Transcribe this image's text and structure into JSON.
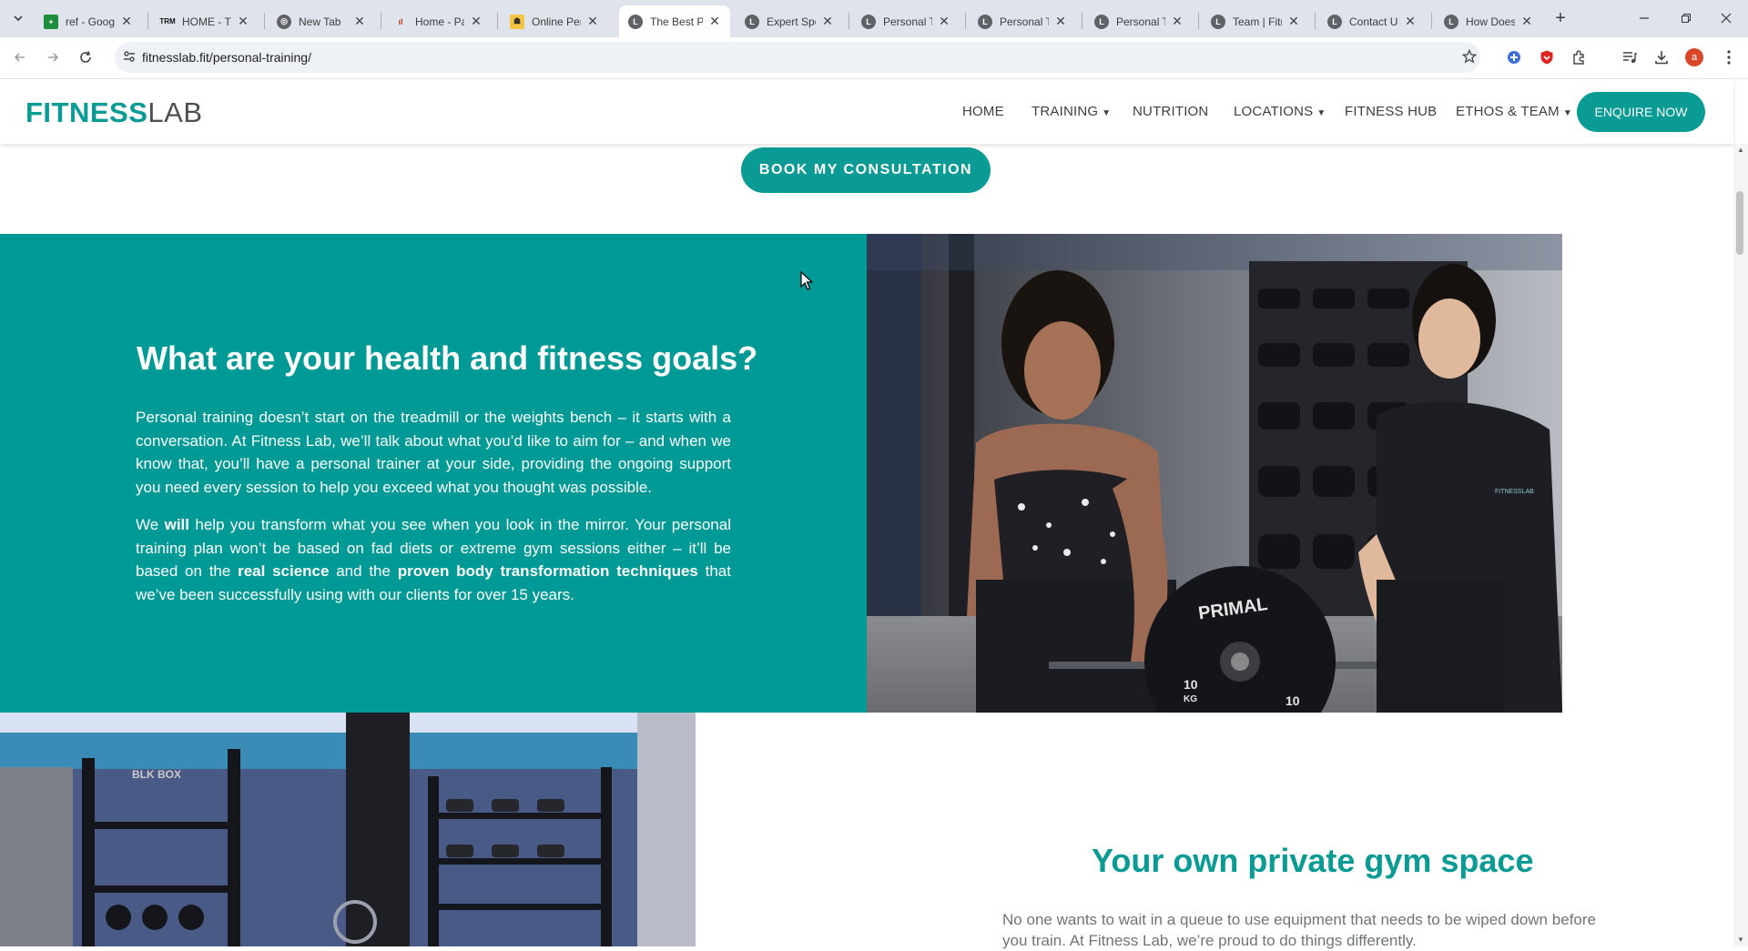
{
  "browser": {
    "tabs": [
      {
        "title": "ref - Goog",
        "icon": "sheets-icon",
        "active": false
      },
      {
        "title": "HOME - Th",
        "icon": "trm-icon",
        "active": false
      },
      {
        "title": "New Tab",
        "icon": "chrome-icon",
        "active": false
      },
      {
        "title": "Home - Pa",
        "icon": "site-icon",
        "active": false
      },
      {
        "title": "Online Per",
        "icon": "site-icon",
        "active": false
      },
      {
        "title": "The Best P",
        "icon": "fitnesslab-icon",
        "active": true
      },
      {
        "title": "Expert Spo",
        "icon": "fitnesslab-icon",
        "active": false
      },
      {
        "title": "Personal Tr",
        "icon": "fitnesslab-icon",
        "active": false
      },
      {
        "title": "Personal Tr",
        "icon": "fitnesslab-icon",
        "active": false
      },
      {
        "title": "Personal Tr",
        "icon": "fitnesslab-icon",
        "active": false
      },
      {
        "title": "Team | Fitn",
        "icon": "fitnesslab-icon",
        "active": false
      },
      {
        "title": "Contact Us",
        "icon": "fitnesslab-icon",
        "active": false
      },
      {
        "title": "How Does",
        "icon": "fitnesslab-icon",
        "active": false
      }
    ],
    "url": "fitnesslab.fit/personal-training/",
    "profile_initial": "a"
  },
  "site": {
    "logo_bold": "FITNESS",
    "logo_light": "LAB",
    "nav": {
      "home": "HOME",
      "training": "TRAINING",
      "nutrition": "NUTRITION",
      "locations": "LOCATIONS",
      "fitness_hub": "FITNESS HUB",
      "ethos_team": "ETHOS & TEAM"
    },
    "enquire": "ENQUIRE NOW",
    "accent": "#0a9b94"
  },
  "content": {
    "book_button": "BOOK MY CONSULTATION",
    "goals_title": "What are your health and fitness goals?",
    "para1": "Personal training doesn’t start on the treadmill or the weights bench – it starts with a conversation. At Fitness Lab, we’ll talk about what you’d like to aim for – and when we know that, you’ll have a personal trainer at your side, providing the ongoing support you need every session to help you exceed what you thought was possible.",
    "para2_a": "We ",
    "para2_b": "will",
    "para2_c": " help you transform what you see when you look in the mirror. Your personal training plan won’t be based on fad diets or extreme gym sessions either – it’ll be based on the ",
    "para2_d": "real science",
    "para2_e": " and the ",
    "para2_f": "proven body transformation techniques",
    "para2_g": " that we’ve been successfully using with our clients for over 15 years.",
    "plate_text_1": "PRIMAL",
    "plate_text_2": "10",
    "plate_text_3": "KG",
    "plate_text_4": "10",
    "shirt_logo": "FITNESSLAB",
    "rack_brand": "BLK BOX",
    "gym_title": "Your own private gym space",
    "gym_text": "No one wants to wait in a queue to use equipment that needs to be wiped down before you train. At Fitness Lab, we’re proud to do things differently."
  }
}
